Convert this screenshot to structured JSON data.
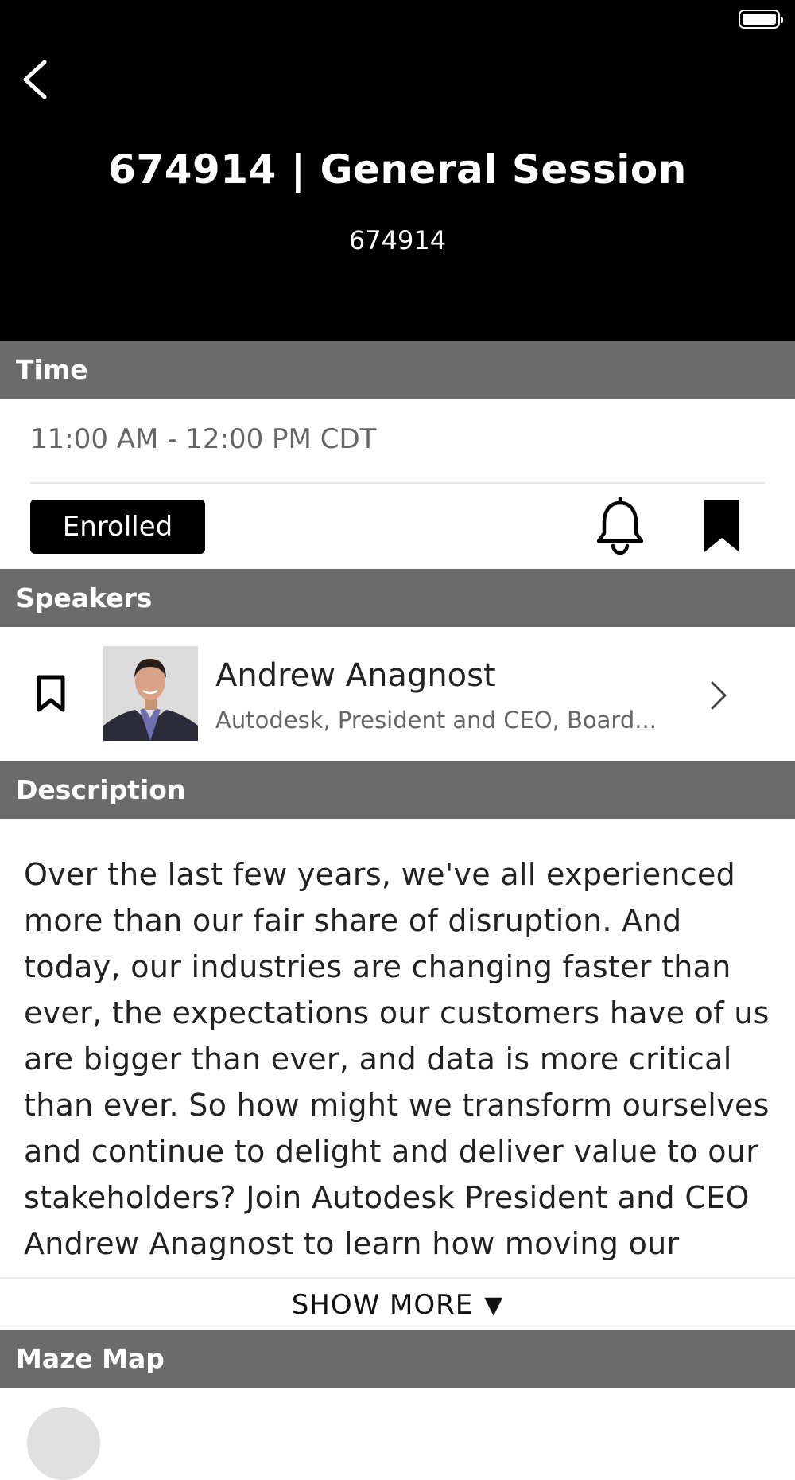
{
  "header": {
    "title": "674914 | General Session",
    "subtitle": "674914"
  },
  "sections": {
    "time": "Time",
    "speakers": "Speakers",
    "description": "Description",
    "maze_map": "Maze Map"
  },
  "time": {
    "value": "11:00 AM - 12:00 PM CDT",
    "enrolled_label": "Enrolled"
  },
  "speaker": {
    "name": "Andrew Anagnost",
    "title": "Autodesk, President and CEO, Board..."
  },
  "description": {
    "text": "Over the last few years, we've all experienced more than our fair share of disruption. And today, our industries are changing faster than ever, the expectations our customers have of us are bigger than ever, and data is more critical than ever. So how might we transform ourselves and continue to delight and deliver value to our stakeholders? Join Autodesk President and CEO Andrew Anagnost to learn how moving our",
    "show_more": "SHOW MORE",
    "show_more_arrow": "▼"
  },
  "icons": {
    "back": "chevron-left-icon",
    "bell": "bell-icon",
    "bookmark": "bookmark-filled-icon",
    "speaker_bookmark": "bookmark-outline-icon",
    "speaker_chevron": "chevron-right-icon"
  },
  "colors": {
    "header_bg": "#000000",
    "section_bar": "#6b6b6b",
    "accent": "#000000"
  }
}
